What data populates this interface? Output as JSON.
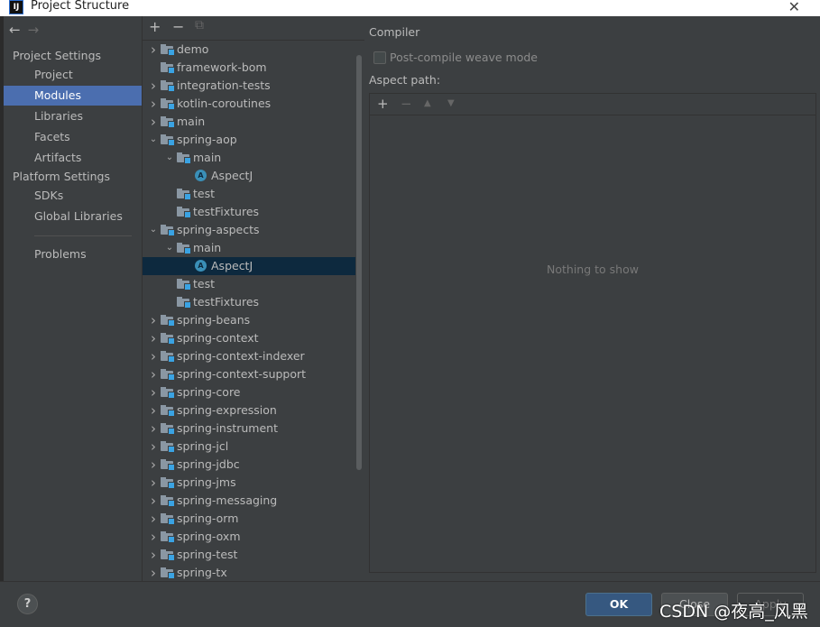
{
  "window": {
    "title": "Project Structure",
    "close_glyph": "✕",
    "app_icon_letter": "IJ"
  },
  "nav": {
    "back_glyph": "←",
    "forward_glyph": "→",
    "project_settings_header": "Project Settings",
    "project_settings": [
      "Project",
      "Modules",
      "Libraries",
      "Facets",
      "Artifacts"
    ],
    "platform_settings_header": "Platform Settings",
    "platform_settings": [
      "SDKs",
      "Global Libraries"
    ],
    "problems": "Problems",
    "selected": "Modules"
  },
  "tree_toolbar": {
    "add": "+",
    "remove": "−",
    "copy": "⧉"
  },
  "tree": [
    {
      "label": "demo",
      "kind": "module",
      "depth": 0,
      "expander": "collapsed"
    },
    {
      "label": "framework-bom",
      "kind": "module",
      "depth": 0,
      "expander": "none"
    },
    {
      "label": "integration-tests",
      "kind": "module",
      "depth": 0,
      "expander": "collapsed"
    },
    {
      "label": "kotlin-coroutines",
      "kind": "module",
      "depth": 0,
      "expander": "collapsed"
    },
    {
      "label": "main",
      "kind": "module",
      "depth": 0,
      "expander": "collapsed"
    },
    {
      "label": "spring-aop",
      "kind": "module",
      "depth": 0,
      "expander": "expanded"
    },
    {
      "label": "main",
      "kind": "module",
      "depth": 1,
      "expander": "expanded"
    },
    {
      "label": "AspectJ",
      "kind": "facet",
      "depth": 2,
      "expander": "none"
    },
    {
      "label": "test",
      "kind": "module",
      "depth": 1,
      "expander": "none"
    },
    {
      "label": "testFixtures",
      "kind": "module",
      "depth": 1,
      "expander": "none"
    },
    {
      "label": "spring-aspects",
      "kind": "module",
      "depth": 0,
      "expander": "expanded"
    },
    {
      "label": "main",
      "kind": "module",
      "depth": 1,
      "expander": "expanded"
    },
    {
      "label": "AspectJ",
      "kind": "facet",
      "depth": 2,
      "expander": "none",
      "selected": true
    },
    {
      "label": "test",
      "kind": "module",
      "depth": 1,
      "expander": "none"
    },
    {
      "label": "testFixtures",
      "kind": "module",
      "depth": 1,
      "expander": "none"
    },
    {
      "label": "spring-beans",
      "kind": "module",
      "depth": 0,
      "expander": "collapsed"
    },
    {
      "label": "spring-context",
      "kind": "module",
      "depth": 0,
      "expander": "collapsed"
    },
    {
      "label": "spring-context-indexer",
      "kind": "module",
      "depth": 0,
      "expander": "collapsed"
    },
    {
      "label": "spring-context-support",
      "kind": "module",
      "depth": 0,
      "expander": "collapsed"
    },
    {
      "label": "spring-core",
      "kind": "module",
      "depth": 0,
      "expander": "collapsed"
    },
    {
      "label": "spring-expression",
      "kind": "module",
      "depth": 0,
      "expander": "collapsed"
    },
    {
      "label": "spring-instrument",
      "kind": "module",
      "depth": 0,
      "expander": "collapsed"
    },
    {
      "label": "spring-jcl",
      "kind": "module",
      "depth": 0,
      "expander": "collapsed"
    },
    {
      "label": "spring-jdbc",
      "kind": "module",
      "depth": 0,
      "expander": "collapsed"
    },
    {
      "label": "spring-jms",
      "kind": "module",
      "depth": 0,
      "expander": "collapsed"
    },
    {
      "label": "spring-messaging",
      "kind": "module",
      "depth": 0,
      "expander": "collapsed"
    },
    {
      "label": "spring-orm",
      "kind": "module",
      "depth": 0,
      "expander": "collapsed"
    },
    {
      "label": "spring-oxm",
      "kind": "module",
      "depth": 0,
      "expander": "collapsed"
    },
    {
      "label": "spring-test",
      "kind": "module",
      "depth": 0,
      "expander": "collapsed"
    },
    {
      "label": "spring-tx",
      "kind": "module",
      "depth": 0,
      "expander": "collapsed"
    }
  ],
  "facet_icon_letter": "A",
  "detail": {
    "section": "Compiler",
    "post_compile_label": "Post-compile weave mode",
    "post_compile_checked": false,
    "aspect_path_label": "Aspect path:",
    "aspect_tools": {
      "add": "+",
      "remove": "−",
      "up": "▲",
      "down": "▼"
    },
    "empty_text": "Nothing to show"
  },
  "buttons": {
    "help": "?",
    "ok": "OK",
    "cancel": "Close",
    "apply": "Apply"
  },
  "watermark": "CSDN @夜高_风黑",
  "colors": {
    "selection": "#4b6eaf",
    "tree_selection": "#0d293e",
    "ok_button": "#365880",
    "facet_icon": "#3a8fb7",
    "module_badge": "#3aa3e3"
  }
}
